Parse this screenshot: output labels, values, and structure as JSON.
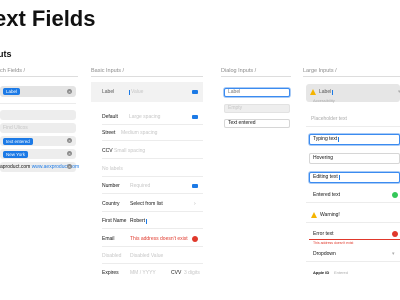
{
  "page": {
    "title": "ext Fields",
    "subtitle": "uts"
  },
  "columns": {
    "search": "ch Fields /",
    "basic": "Basic Inputs /",
    "dialog": "Dialog Inputs /",
    "large": "Large Inputs /"
  },
  "search": {
    "token1": "Label",
    "placeholder": "Find Ulicos",
    "token2": "text entered",
    "token3": "New York",
    "url": "aproduct.com ",
    "url_link": "www.aexproduct.com"
  },
  "basic": {
    "label_row": {
      "label": "Label",
      "value": "Value"
    },
    "default_row": {
      "label": "Default",
      "placeholder": "Large spacing"
    },
    "street_row": {
      "label": "Street",
      "placeholder": "Medium spacing"
    },
    "ccv_row": {
      "label": "CCV",
      "placeholder": "Small spacing"
    },
    "nolabel_placeholder": "No labels",
    "number_row": {
      "label": "Number",
      "placeholder": "Required"
    },
    "country_row": {
      "label": "Country",
      "value": "Select from list"
    },
    "firstname_row": {
      "label": "First Name",
      "value": "Robert"
    },
    "email_row": {
      "label": "Email",
      "error": "This address doesn't exist"
    },
    "disabled_row": {
      "label": "Disabled",
      "value": "Disabled Value"
    },
    "expires_row": {
      "label": "Expires",
      "placeholder": "MM / YYYY",
      "ccv_label": "CVV",
      "ccv_placeholder": "3 digits"
    }
  },
  "dialog": {
    "value": "Label",
    "placeholder": "Empty",
    "entered": "Text entered"
  },
  "large": {
    "label": "Label",
    "caption": "Accessibility",
    "placeholder": "Placeholder text",
    "typing": "Typing text",
    "hovering": "Hovering",
    "editing": "Editing text",
    "entered": "Entered text",
    "warning": "Warning!",
    "error": "Error text",
    "error_hint": "This address doesn't exist",
    "dropdown": "Dropdown",
    "apple_id_label": "Apple ID",
    "apple_id_value": "Entered"
  },
  "colors": {
    "accent": "#1c7ae6",
    "error": "#e0382b",
    "warning": "#f5b400",
    "success": "#34c759",
    "field_fill": "#ededed"
  },
  "icons": [
    "clear-icon",
    "camera-icon",
    "chevron-down-icon",
    "chevron-right-icon",
    "error-icon",
    "warning-icon"
  ]
}
